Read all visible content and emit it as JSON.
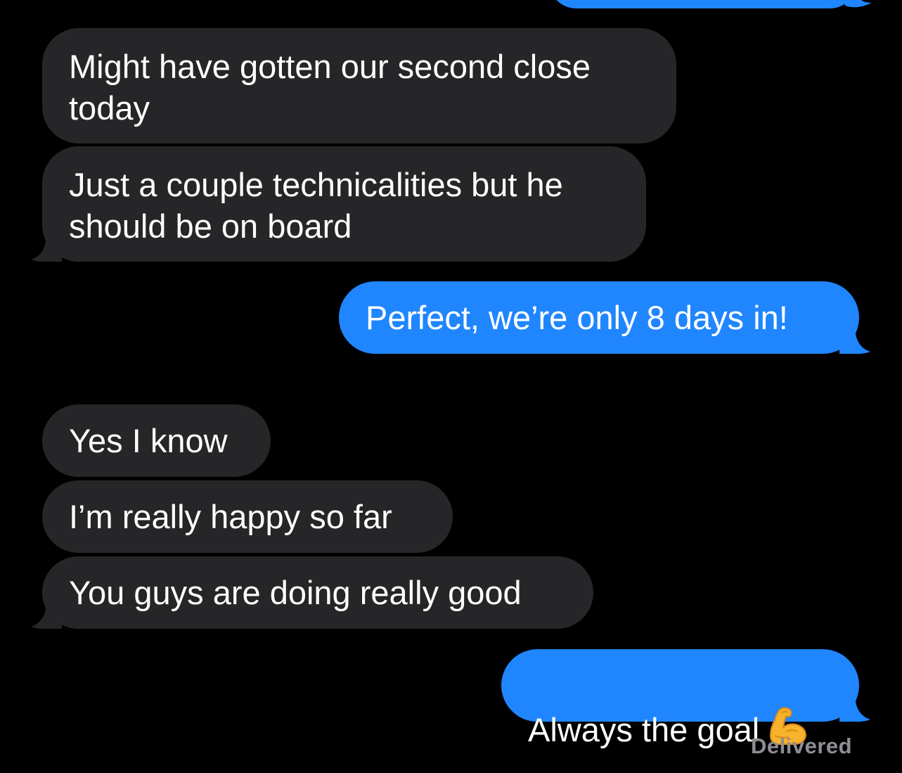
{
  "conversation": {
    "messages": [
      {
        "sender": "them",
        "text": "Might have gotten our second close\ntoday"
      },
      {
        "sender": "them",
        "text": "Just a couple technicalities but he\nshould be on board"
      },
      {
        "sender": "me",
        "text": "Perfect, we’re only 8 days in!"
      },
      {
        "sender": "them",
        "text": "Yes I know"
      },
      {
        "sender": "them",
        "text": "I’m really happy so far"
      },
      {
        "sender": "them",
        "text": "You guys are doing really good"
      },
      {
        "sender": "me",
        "text": "Always the goal",
        "emoji": "flexed-biceps"
      }
    ],
    "status": "Delivered"
  },
  "colors": {
    "background": "#000000",
    "incoming_bubble": "#262628",
    "outgoing_bubble": "#1f86ff",
    "text": "#ffffff",
    "status_text": "#8e8e93"
  }
}
